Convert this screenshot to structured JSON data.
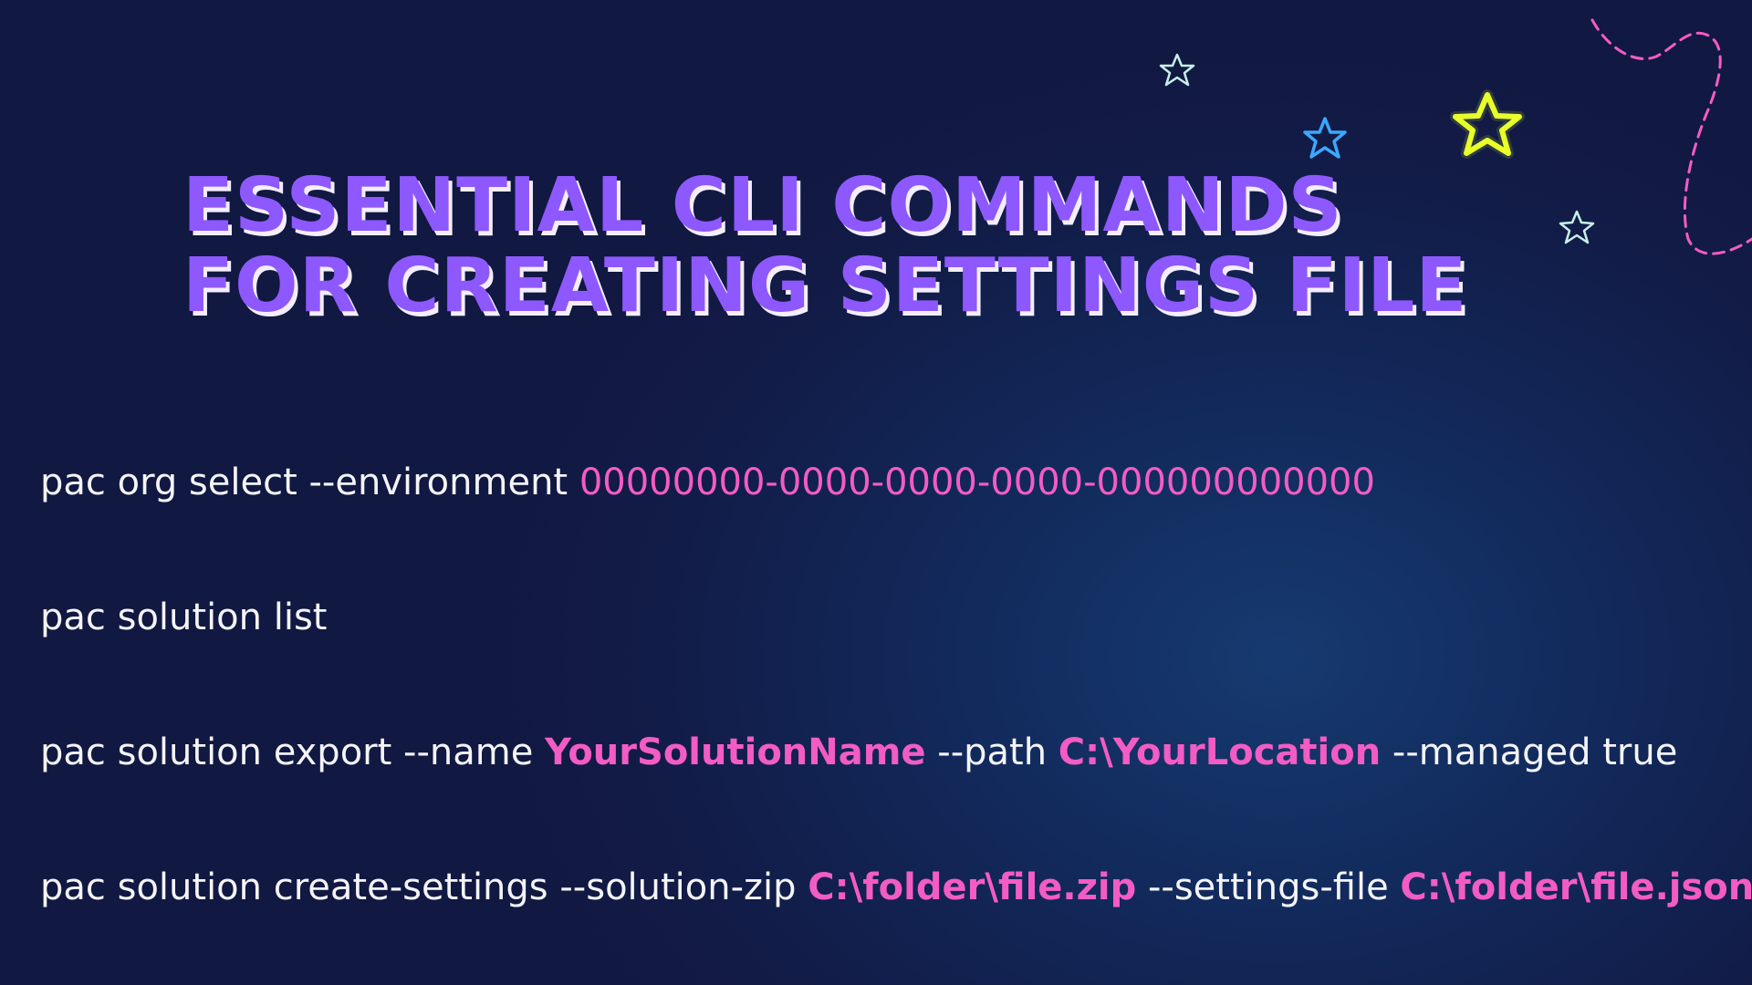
{
  "title": {
    "line1": "ESSENTIAL CLI COMMANDS",
    "line2": "FOR CREATING SETTINGS FILE"
  },
  "commands": [
    {
      "parts": [
        "pac org select --environment ",
        "00000000-0000-0000-0000-000000000000"
      ]
    },
    {
      "parts": [
        "pac solution list"
      ]
    },
    {
      "parts": [
        "pac solution export --name ",
        "YourSolutionName",
        " --path ",
        "C:\\YourLocation",
        " --managed true"
      ]
    },
    {
      "parts": [
        "pac solution create-settings --solution-zip ",
        "C:\\folder\\file.zip",
        " --settings-file ",
        "C:\\folder\\file.json"
      ]
    }
  ],
  "colors": {
    "background": "#121c48",
    "title": "#8e58ff",
    "title_shadow": "#f3eefe",
    "text": "#f4f4f8",
    "highlight": "#f35cc4",
    "star_yellow": "#e8ff2a",
    "star_blue": "#3aa8ff",
    "star_pale": "#c8f0e8",
    "swirl": "#f35cc4"
  },
  "decorations": [
    "star-icon",
    "star-icon",
    "star-icon",
    "star-icon",
    "dashed-swirl"
  ]
}
